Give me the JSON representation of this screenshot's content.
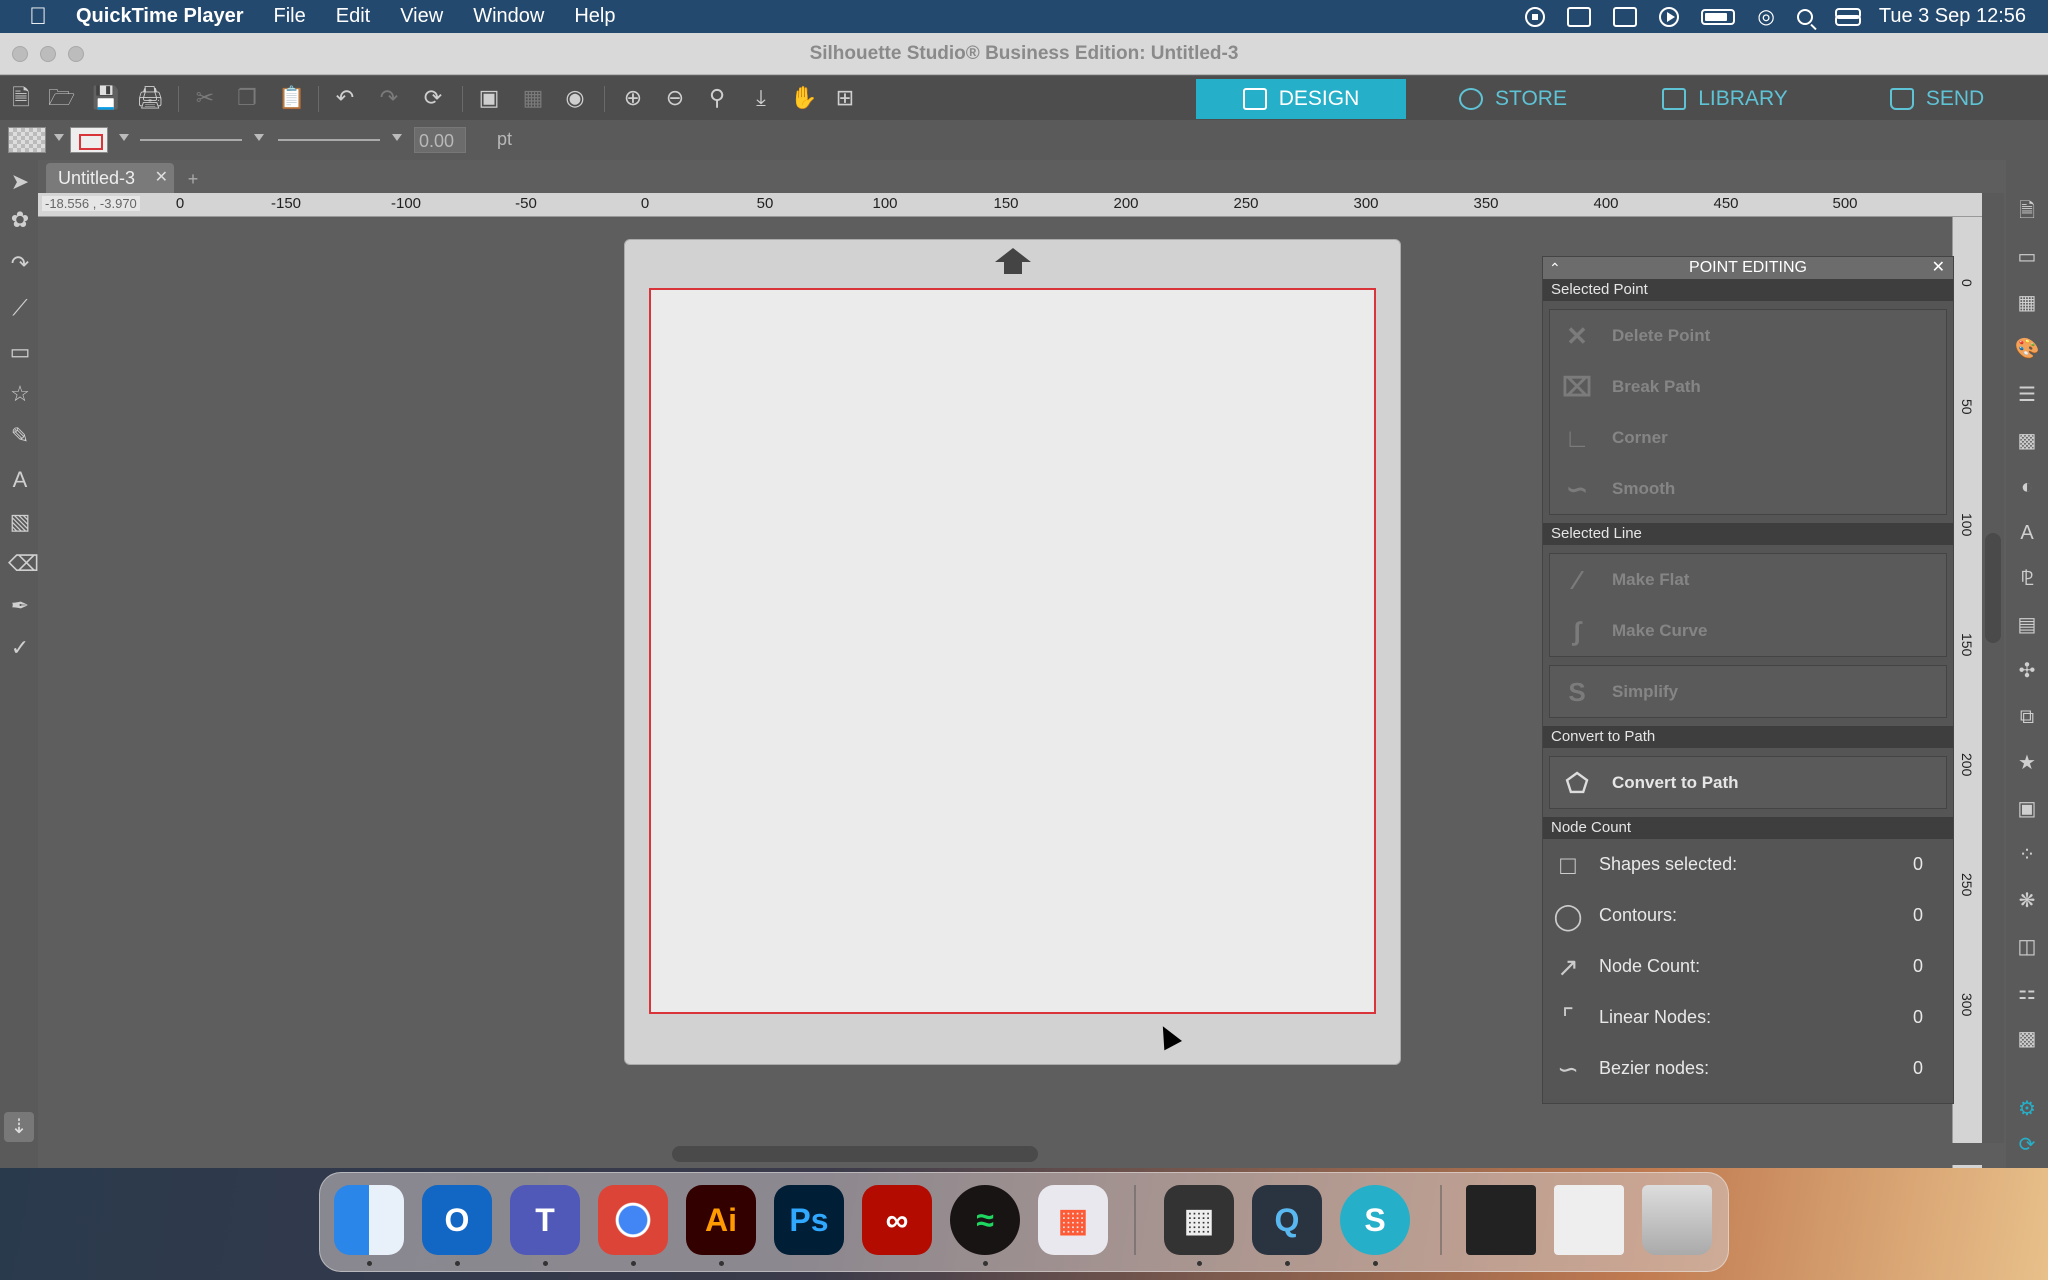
{
  "menubar": {
    "app_name": "QuickTime Player",
    "menus": [
      "File",
      "Edit",
      "View",
      "Window",
      "Help"
    ],
    "clock": "Tue 3 Sep  12:56"
  },
  "window": {
    "title": "Silhouette Studio® Business Edition: Untitled-3"
  },
  "main_tabs": [
    {
      "label": "DESIGN",
      "icon": "grid-icon"
    },
    {
      "label": "STORE",
      "icon": "store-icon"
    },
    {
      "label": "LIBRARY",
      "icon": "library-icon"
    },
    {
      "label": "SEND",
      "icon": "send-icon"
    }
  ],
  "linebar": {
    "line_width": "0.00",
    "unit": "pt"
  },
  "document_tab": {
    "name": "Untitled-3"
  },
  "ruler": {
    "coordinate_readout": "-18.556 , -3.970",
    "h_labels": [
      "-150",
      "-100",
      "-50",
      "0",
      "50",
      "100",
      "150",
      "200",
      "250",
      "300",
      "350",
      "400",
      "450",
      "500"
    ],
    "corner_labels": [
      "250",
      "0"
    ],
    "v_labels": [
      "0",
      "50",
      "100",
      "150",
      "200",
      "250",
      "300"
    ]
  },
  "panel": {
    "title": "POINT EDITING",
    "sections": {
      "selected_point": "Selected Point",
      "selected_line": "Selected Line",
      "convert_to_path": "Convert to Path",
      "node_count": "Node Count"
    },
    "point_buttons": [
      "Delete Point",
      "Break Path",
      "Corner",
      "Smooth"
    ],
    "line_buttons": [
      "Make Flat",
      "Make Curve"
    ],
    "simplify": "Simplify",
    "convert_button": "Convert to Path",
    "stats": [
      {
        "label": "Shapes selected:",
        "value": "0"
      },
      {
        "label": "Contours:",
        "value": "0"
      },
      {
        "label": "Node Count:",
        "value": "0"
      },
      {
        "label": "Linear Nodes:",
        "value": "0"
      },
      {
        "label": "Bezier nodes:",
        "value": "0"
      }
    ]
  },
  "dock": {
    "apps": [
      "Finder",
      "Outlook",
      "Teams",
      "Chrome",
      "Illustrator",
      "Photoshop",
      "Acrobat",
      "Spotify",
      "Launchpad",
      "Calculator",
      "QuickTime Player",
      "Silhouette Studio"
    ],
    "icon_text": {
      "illustrator": "Ai",
      "photoshop": "Ps"
    }
  },
  "colors": {
    "accent": "#26afc8",
    "page_border": "#d9343a",
    "menubar": "#24496e"
  }
}
